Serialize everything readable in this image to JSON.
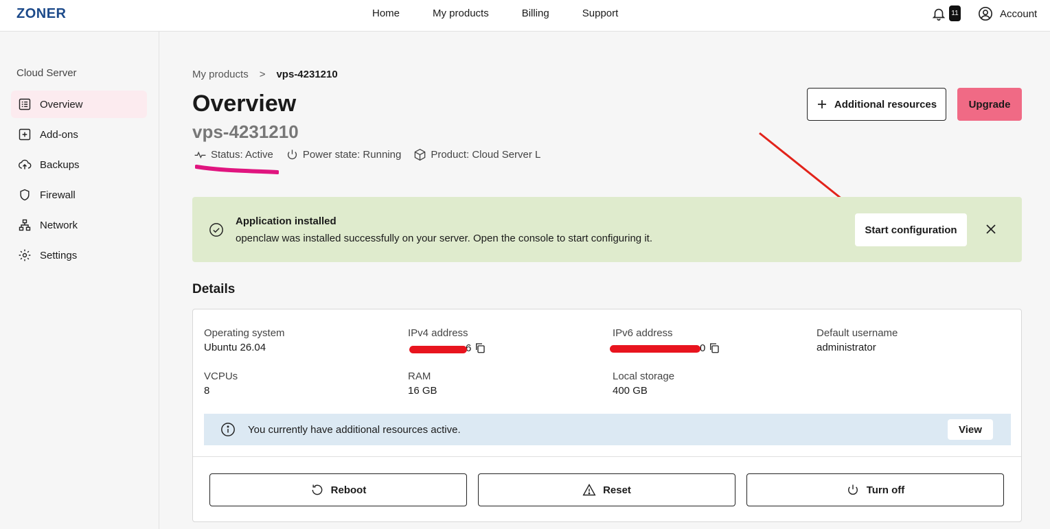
{
  "brand": "ZONER",
  "nav": {
    "home": "Home",
    "products": "My products",
    "billing": "Billing",
    "support": "Support"
  },
  "notifications": {
    "count": "11"
  },
  "account": {
    "label": "Account"
  },
  "sidebar": {
    "title": "Cloud Server",
    "items": [
      {
        "label": "Overview",
        "icon": "list-icon",
        "active": true
      },
      {
        "label": "Add-ons",
        "icon": "plus-square-icon"
      },
      {
        "label": "Backups",
        "icon": "cloud-upload-icon"
      },
      {
        "label": "Firewall",
        "icon": "shield-icon"
      },
      {
        "label": "Network",
        "icon": "network-icon"
      },
      {
        "label": "Settings",
        "icon": "gear-icon"
      }
    ]
  },
  "breadcrumb": {
    "parent": "My products",
    "separator": ">",
    "current": "vps-4231210"
  },
  "page": {
    "title": "Overview",
    "subtitle": "vps-4231210"
  },
  "meta": {
    "status": "Status: Active",
    "power": "Power state: Running",
    "product": "Product: Cloud Server L"
  },
  "actions": {
    "additional": "Additional resources",
    "upgrade": "Upgrade"
  },
  "alert": {
    "title": "Application installed",
    "message": "openclaw was installed successfully on your server. Open the console to start configuring it.",
    "button": "Start configuration"
  },
  "details": {
    "heading": "Details",
    "os_label": "Operating system",
    "os_value": "Ubuntu 26.04",
    "ipv4_label": "IPv4 address",
    "ipv4_tail": "6",
    "ipv6_label": "IPv6 address",
    "ipv6_tail": "0",
    "user_label": "Default username",
    "user_value": "administrator",
    "vcpu_label": "VCPUs",
    "vcpu_value": "8",
    "ram_label": "RAM",
    "ram_value": "16 GB",
    "storage_label": "Local storage",
    "storage_value": "400 GB"
  },
  "info": {
    "text": "You currently have additional resources active.",
    "button": "View"
  },
  "power_actions": {
    "reboot": "Reboot",
    "reset": "Reset",
    "turnoff": "Turn off"
  },
  "colors": {
    "accent": "#f06a85",
    "alert_bg": "#dfebcd",
    "info_bg": "#dce9f3",
    "brand": "#1c4a8a"
  }
}
